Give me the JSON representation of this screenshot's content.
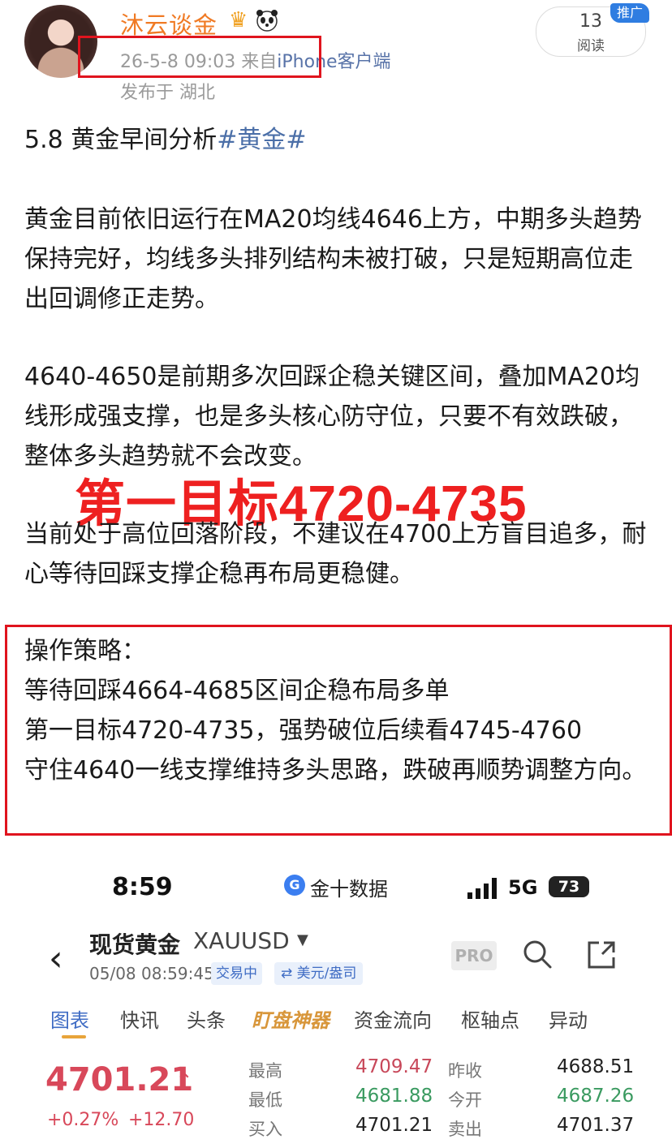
{
  "post": {
    "username": "沐云谈金",
    "datetime": "26-5-8 09:03",
    "source_prefix": "来自",
    "source": "iPhone客户端",
    "location": "发布于 湖北",
    "reads_count": "13",
    "reads_label": "阅读",
    "promo_badge": "推广",
    "title_text": "5.8 黄金早间分析",
    "title_tag": "#黄金#",
    "paragraph1": "黄金目前依旧运行在MA20均线4646上方，中期多头趋势保持完好，均线多头排列结构未被打破，只是短期高位走出回调修正走势。",
    "paragraph2": "4640-4650是前期多次回踩企稳关键区间，叠加MA20均线形成强支撑，也是多头核心防守位，只要不有效跌破，整体多头趋势就不会改变。",
    "overlay_title": "第一目标4720-4735",
    "paragraph3": "当前处于高位回落阶段，不建议在4700上方盲目追多，耐心等待回踩支撑企稳再布局更稳健。",
    "strategy_heading": "操作策略：",
    "strategy_line1": "等待回踩4664-4685区间企稳布局多单",
    "strategy_line2": "第一目标4720-4735，强势破位后续看4745-4760",
    "strategy_line3": "守住4640一线支撑维持多头思路，跌破再顺势调整方向。"
  },
  "phone": {
    "status_time": "8:59",
    "app_name": "金十数据",
    "network": "5G",
    "battery": "73"
  },
  "quote": {
    "name": "现货黄金",
    "symbol": "XAUUSD",
    "time": "05/08 08:59:45",
    "status": "交易中",
    "unit": "⇄ 美元/盎司",
    "pro_label": "PRO",
    "tabs": [
      "图表",
      "快讯",
      "头条",
      "盯盘神器",
      "资金流向",
      "枢轴点",
      "异动"
    ],
    "price": "4701.21",
    "change_pct": "+0.27%",
    "change_abs": "+12.70",
    "high_label": "最高",
    "high_value": "4709.47",
    "low_label": "最低",
    "low_value": "4681.88",
    "bid_label": "买入",
    "bid_value": "4701.21",
    "prev_close_label": "昨收",
    "prev_close_value": "4688.51",
    "open_label": "今开",
    "open_value": "4687.26",
    "ask_label": "卖出",
    "ask_value": "4701.37"
  },
  "colors": {
    "username": "#f07a24",
    "highlight_red": "#e0141e",
    "tag_blue": "#4b6fa8",
    "price_red": "#d8485a",
    "price_green": "#3a9a60"
  },
  "icons": [
    "crown-icon",
    "panda-icon",
    "back-icon",
    "search-icon",
    "share-icon",
    "signal-icon",
    "battery-icon"
  ]
}
